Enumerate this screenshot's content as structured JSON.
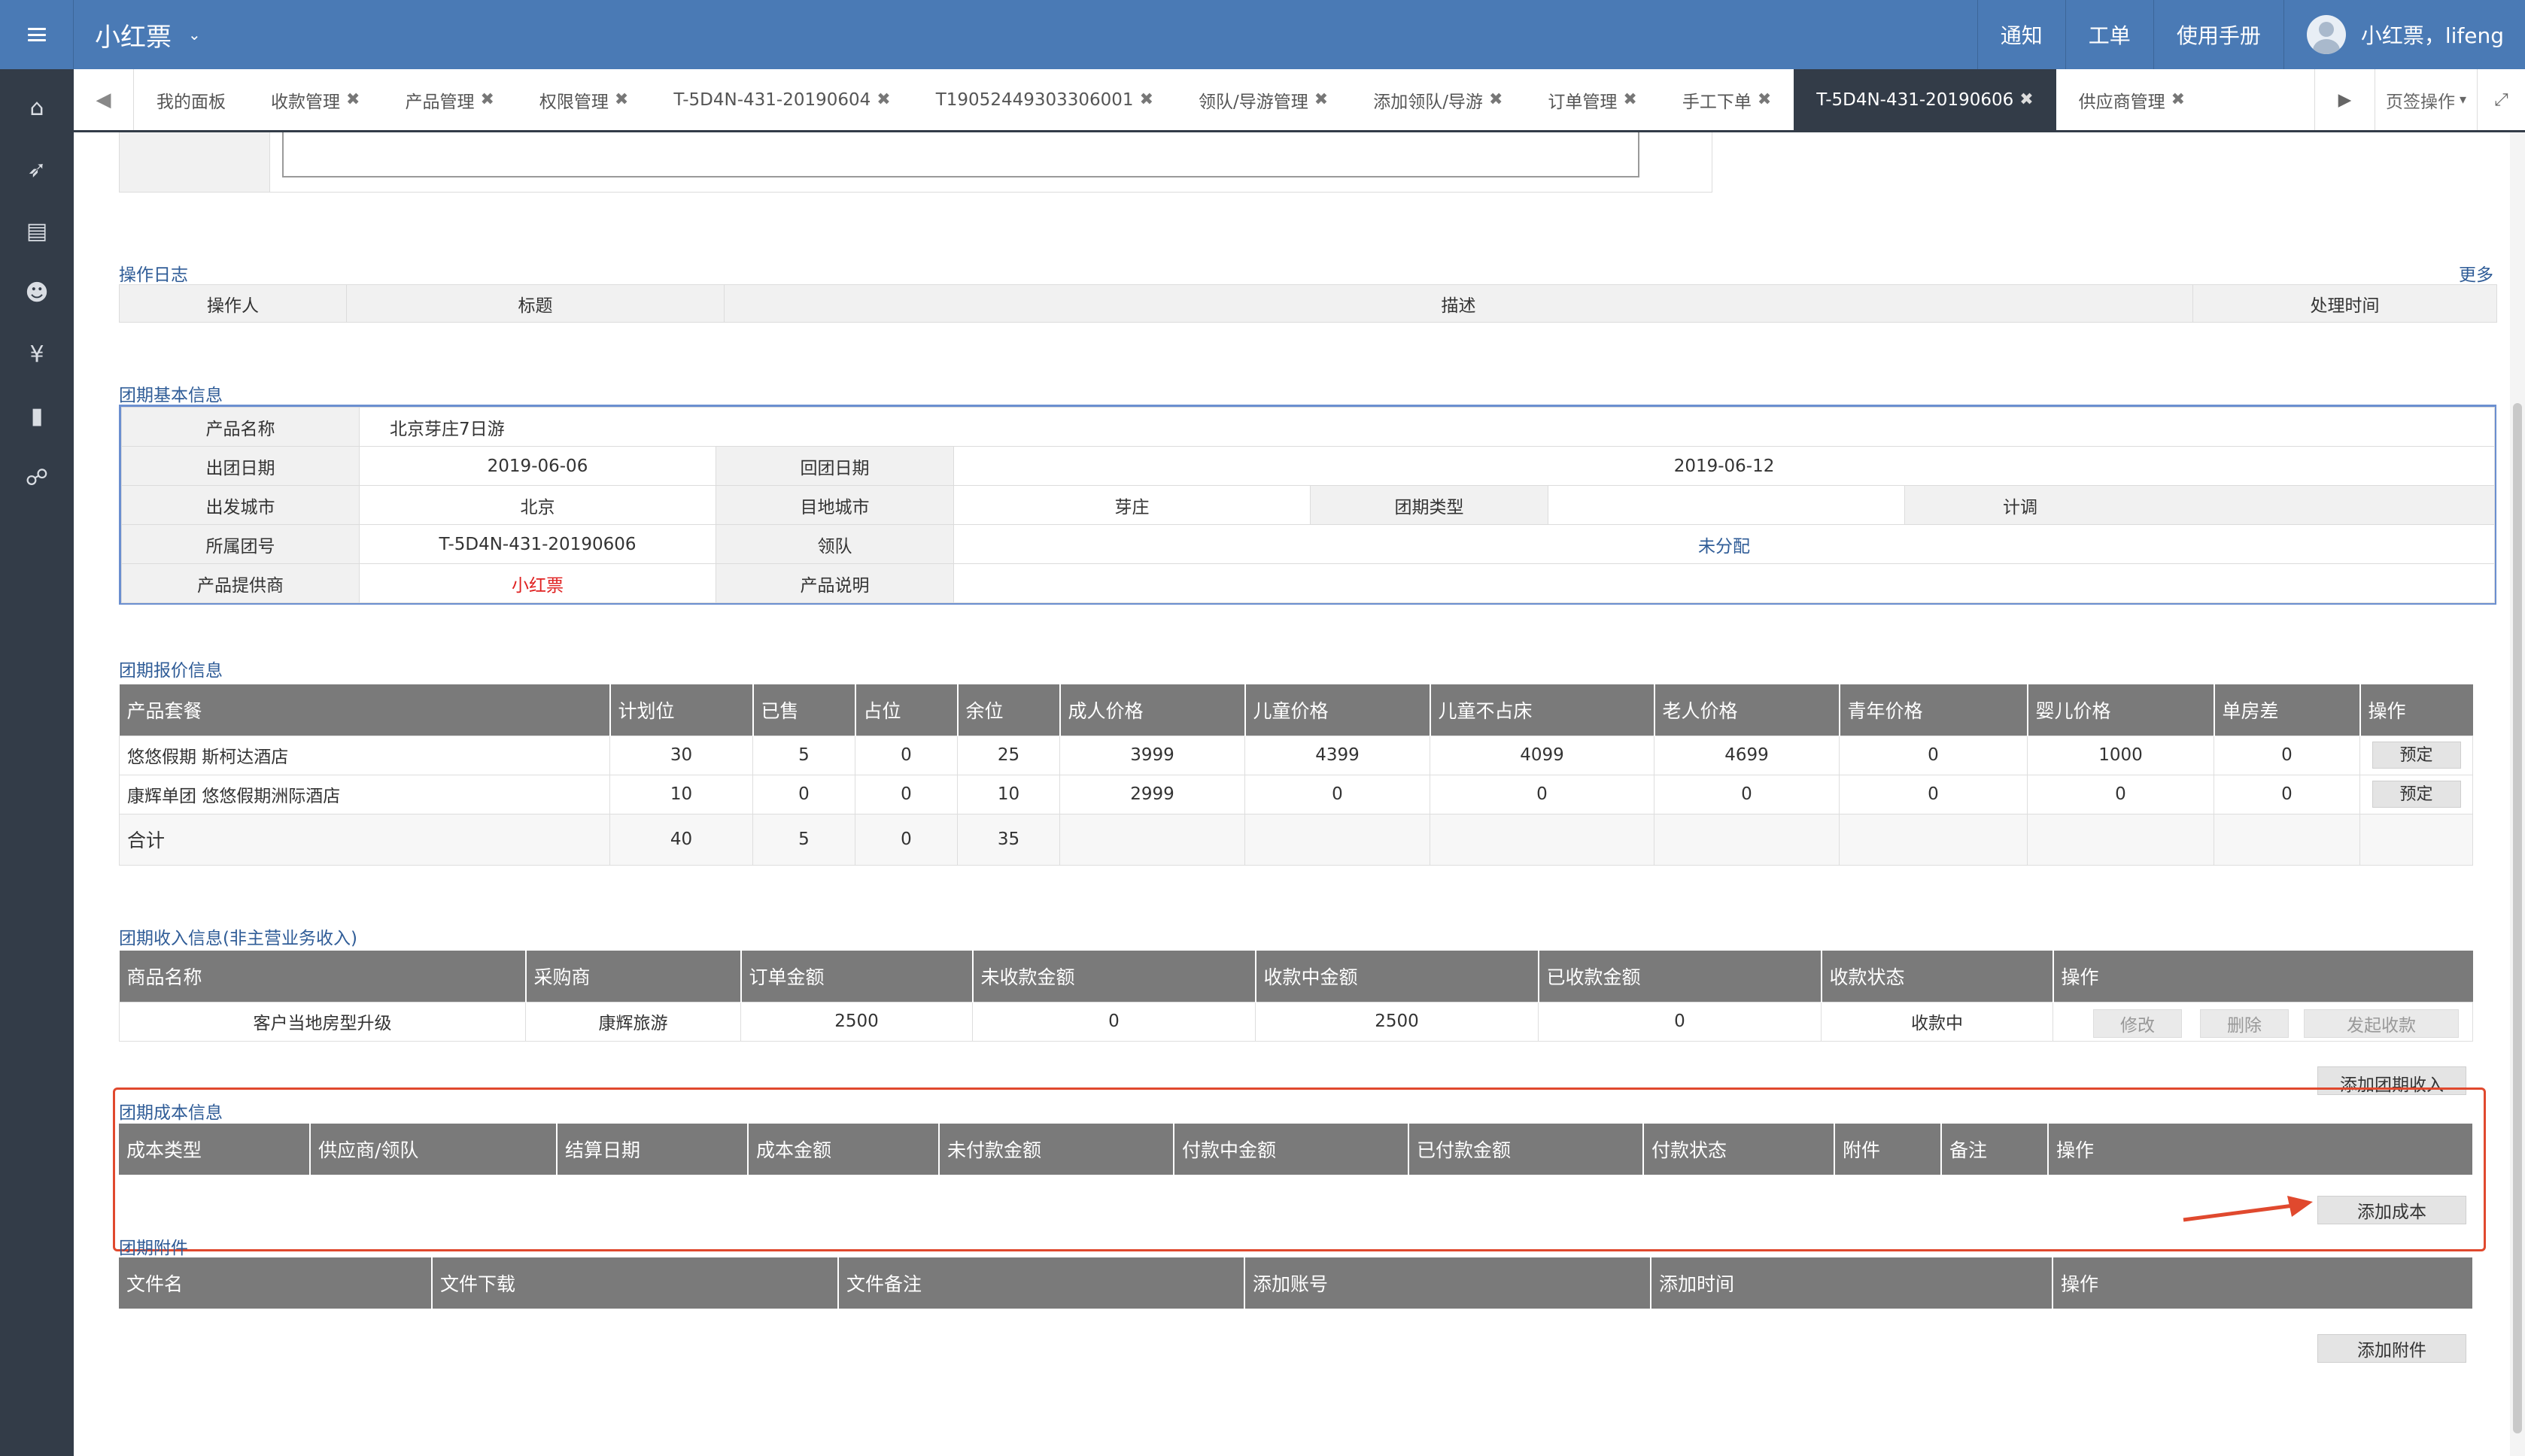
{
  "header": {
    "brand": "小红票",
    "nav": [
      "通知",
      "工单",
      "使用手册"
    ],
    "user_name": "小红票，lifeng"
  },
  "sidebar": {
    "icons": [
      "home-icon",
      "rocket-icon",
      "list-icon",
      "user-icon",
      "yen-icon",
      "bar-chart-icon",
      "sitemap-icon"
    ],
    "glyphs": [
      "⌂",
      "➶",
      "▤",
      "☻",
      "¥",
      "▮",
      "☍"
    ]
  },
  "tabs": [
    {
      "label": "我的面板",
      "closable": false
    },
    {
      "label": "收款管理",
      "closable": true
    },
    {
      "label": "产品管理",
      "closable": true
    },
    {
      "label": "权限管理",
      "closable": true
    },
    {
      "label": "T-5D4N-431-20190604",
      "closable": true
    },
    {
      "label": "T19052449303306001",
      "closable": true
    },
    {
      "label": "领队/导游管理",
      "closable": true
    },
    {
      "label": "添加领队/导游",
      "closable": true
    },
    {
      "label": "订单管理",
      "closable": true
    },
    {
      "label": "手工下单",
      "closable": true
    },
    {
      "label": "T-5D4N-431-20190606",
      "closable": true,
      "active": true
    },
    {
      "label": "供应商管理",
      "closable": true
    }
  ],
  "tab_close_glyph": "✖",
  "tab_controls": {
    "page_ops": "页签操作",
    "prev": "◀",
    "next": "▶",
    "expand": "⤢",
    "caret": "▾"
  },
  "op_log": {
    "title": "操作日志",
    "more": "更多",
    "columns": [
      "操作人",
      "标题",
      "描述",
      "处理时间"
    ]
  },
  "basic_info": {
    "title": "团期基本信息",
    "product_name_label": "产品名称",
    "product_name": "北京芽庄7日游",
    "depart_date_label": "出团日期",
    "depart_date": "2019-06-06",
    "return_date_label": "回团日期",
    "return_date": "2019-06-12",
    "depart_city_label": "出发城市",
    "depart_city": "北京",
    "dest_city_label": "目地城市",
    "dest_city": "芽庄",
    "group_type_label": "团期类型",
    "group_type": "计调",
    "group_no_label": "所属团号",
    "group_no": "T-5D4N-431-20190606",
    "leader_label": "领队",
    "leader": "未分配",
    "supplier_label": "产品提供商",
    "supplier": "小红票",
    "desc_label": "产品说明",
    "desc": ""
  },
  "pricing": {
    "title": "团期报价信息",
    "columns": [
      "产品套餐",
      "计划位",
      "已售",
      "占位",
      "余位",
      "成人价格",
      "儿童价格",
      "儿童不占床",
      "老人价格",
      "青年价格",
      "婴儿价格",
      "单房差",
      "操作"
    ],
    "rows": [
      {
        "package": "悠悠假期 斯柯达酒店",
        "plan": "30",
        "sold": "5",
        "held": "0",
        "left": "25",
        "adult": "3999",
        "child": "4399",
        "child_nobed": "4099",
        "senior": "4699",
        "youth": "0",
        "infant": "1000",
        "single": "0",
        "action": "预定"
      },
      {
        "package": "康辉单团 悠悠假期洲际酒店",
        "plan": "10",
        "sold": "0",
        "held": "0",
        "left": "10",
        "adult": "2999",
        "child": "0",
        "child_nobed": "0",
        "senior": "0",
        "youth": "0",
        "infant": "0",
        "single": "0",
        "action": "预定"
      }
    ],
    "total": {
      "label": "合计",
      "plan": "40",
      "sold": "5",
      "held": "0",
      "left": "35"
    }
  },
  "income": {
    "title": "团期收入信息(非主营业务收入)",
    "columns": [
      "商品名称",
      "采购商",
      "订单金额",
      "未收款金额",
      "收款中金额",
      "已收款金额",
      "收款状态",
      "操作"
    ],
    "row": {
      "name": "客户当地房型升级",
      "buyer": "康辉旅游",
      "order_amount": "2500",
      "unpaid": "0",
      "collecting": "2500",
      "collected": "0",
      "status": "收款中"
    },
    "row_actions": [
      "修改",
      "删除",
      "发起收款"
    ],
    "add_button": "添加团期收入"
  },
  "cost": {
    "title": "团期成本信息",
    "columns": [
      "成本类型",
      "供应商/领队",
      "结算日期",
      "成本金额",
      "未付款金额",
      "付款中金额",
      "已付款金额",
      "付款状态",
      "附件",
      "备注",
      "操作"
    ],
    "add_button": "添加成本"
  },
  "attachments": {
    "title": "团期附件",
    "columns": [
      "文件名",
      "文件下载",
      "文件备注",
      "添加账号",
      "添加时间",
      "操作"
    ],
    "add_button": "添加附件"
  },
  "colors": {
    "header_bg": "#4a7ab5",
    "sidebar_bg": "#333c48",
    "table_header_bg": "#7a7a7a",
    "link": "#2f5c97",
    "highlight": "#e0492e",
    "supplier_red": "#e02020"
  }
}
